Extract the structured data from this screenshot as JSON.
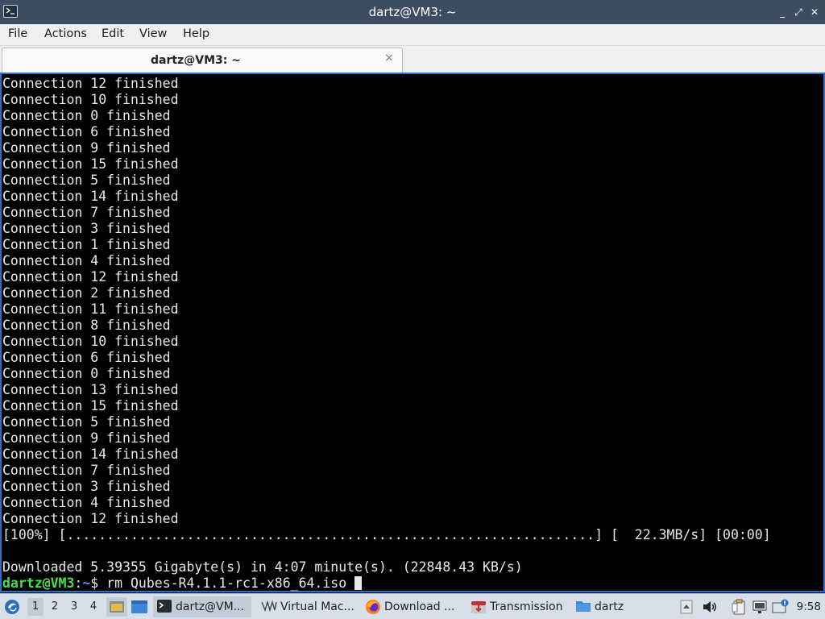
{
  "window": {
    "title": "dartz@VM3: ~",
    "minimize": "_",
    "restore": "⤢",
    "close": "✕"
  },
  "menu": [
    "File",
    "Actions",
    "Edit",
    "View",
    "Help"
  ],
  "tab": {
    "label": "dartz@VM3: ~",
    "close": "×"
  },
  "terminal": {
    "lines": [
      "Connection 12 finished",
      "Connection 10 finished",
      "Connection 0 finished",
      "Connection 6 finished",
      "Connection 9 finished",
      "Connection 15 finished",
      "Connection 5 finished",
      "Connection 14 finished",
      "Connection 7 finished",
      "Connection 3 finished",
      "Connection 1 finished",
      "Connection 4 finished",
      "Connection 12 finished",
      "Connection 2 finished",
      "Connection 11 finished",
      "Connection 8 finished",
      "Connection 10 finished",
      "Connection 6 finished",
      "Connection 0 finished",
      "Connection 13 finished",
      "Connection 15 finished",
      "Connection 5 finished",
      "Connection 9 finished",
      "Connection 14 finished",
      "Connection 7 finished",
      "Connection 3 finished",
      "Connection 4 finished",
      "Connection 12 finished",
      "[100%] [..................................................................] [  22.3MB/s] [00:00]",
      "",
      "Downloaded 5.39355 Gigabyte(s) in 4:07 minute(s). (22848.43 KB/s)"
    ],
    "prompt_user": "dartz@VM3",
    "prompt_sep": ":",
    "prompt_path": "~",
    "prompt_symbol": "$ ",
    "command": "rm Qubes-R4.1.1-rc1-x86_64.iso "
  },
  "taskbar": {
    "desktops": [
      "1",
      "2",
      "3",
      "4"
    ],
    "active_desktop": "1",
    "tasks": [
      {
        "label": "dartz@VM...",
        "icon": "terminal-icon"
      },
      {
        "label": "Virtual Mac...",
        "icon": "virtualbox-icon"
      },
      {
        "label": "Download ...",
        "icon": "firefox-icon"
      },
      {
        "label": "Transmission",
        "icon": "transmission-icon"
      },
      {
        "label": "dartz",
        "icon": "folder-icon"
      }
    ],
    "clock": "9:58"
  },
  "colors": {
    "titlebar": "#3c4d62",
    "prompt_user": "#4ae04a",
    "prompt_path": "#5f8ff0",
    "taskbar": "#d8dfe8"
  }
}
